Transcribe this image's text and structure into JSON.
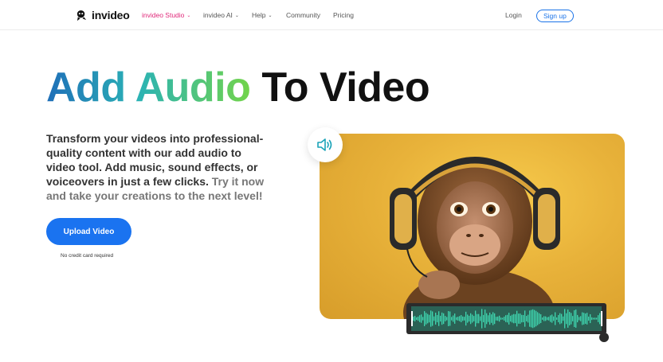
{
  "brand": {
    "name": "invideo",
    "icon": "invideo-logo-icon"
  },
  "nav": {
    "items": [
      {
        "label": "invideo Studio",
        "caret": "⌄",
        "active": true
      },
      {
        "label": "invideo AI",
        "caret": "⌄"
      },
      {
        "label": "Help",
        "caret": "⌄"
      },
      {
        "label": "Community"
      },
      {
        "label": "Pricing"
      }
    ],
    "login": "Login",
    "signup": "Sign up"
  },
  "hero": {
    "title_highlight": "Add Audio",
    "title_rest": "To Video",
    "description": "Transform your videos into professional-quality content with our add audio to video tool. Add music, sound effects, or voiceovers in just a few clicks.",
    "description_muted": "Try it now and take your creations to the next level!",
    "cta": "Upload Video",
    "cta_note": "No credit card required"
  },
  "media": {
    "image": "monkey-with-headphones",
    "speaker_icon": "speaker-volume-icon",
    "waveform_icon": "audio-waveform"
  },
  "colors": {
    "accent": "#1a73f0",
    "active_nav": "#e0297a",
    "waveform": "#3fd6b0"
  }
}
